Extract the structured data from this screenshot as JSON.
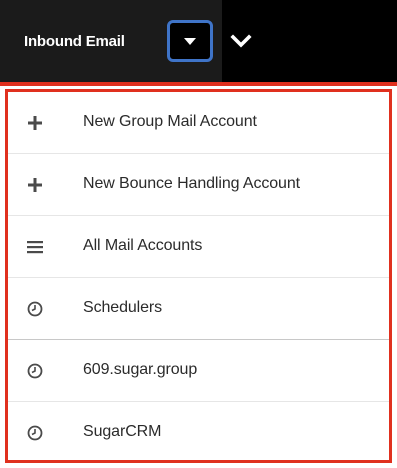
{
  "nav": {
    "module_label": "Inbound Email"
  },
  "menu": {
    "items": [
      {
        "label": "New Group Mail Account",
        "icon": "plus-icon"
      },
      {
        "label": "New Bounce Handling Account",
        "icon": "plus-icon"
      },
      {
        "label": "All Mail Accounts",
        "icon": "list-icon"
      },
      {
        "label": "Schedulers",
        "icon": "clock-icon"
      },
      {
        "label": "609.sugar.group",
        "icon": "clock-icon"
      },
      {
        "label": "SugarCRM",
        "icon": "clock-icon"
      }
    ]
  },
  "colors": {
    "highlight_border": "#e0301e",
    "toggle_border": "#3f74c8",
    "topbar": "#000000"
  }
}
